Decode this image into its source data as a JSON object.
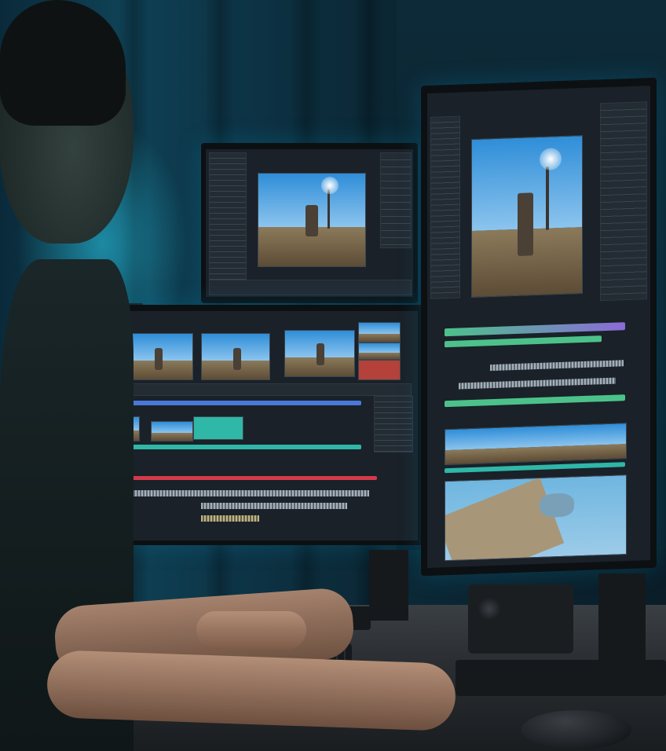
{
  "scene": {
    "description_free": true,
    "colors": {
      "room_glow": "#2bc8e6",
      "curtain": "#0e3a4c",
      "screen_ui": "#1a2128",
      "timeline_teal": "#2fb7a8",
      "timeline_red": "#d43a4a",
      "timeline_blue": "#4a78d8",
      "timeline_green": "#4cc28a",
      "desk": "#2a2e32"
    },
    "icons": [
      "monitor-top",
      "monitor-center",
      "monitor-right",
      "keyboard",
      "mouse",
      "speaker",
      "plant"
    ]
  }
}
